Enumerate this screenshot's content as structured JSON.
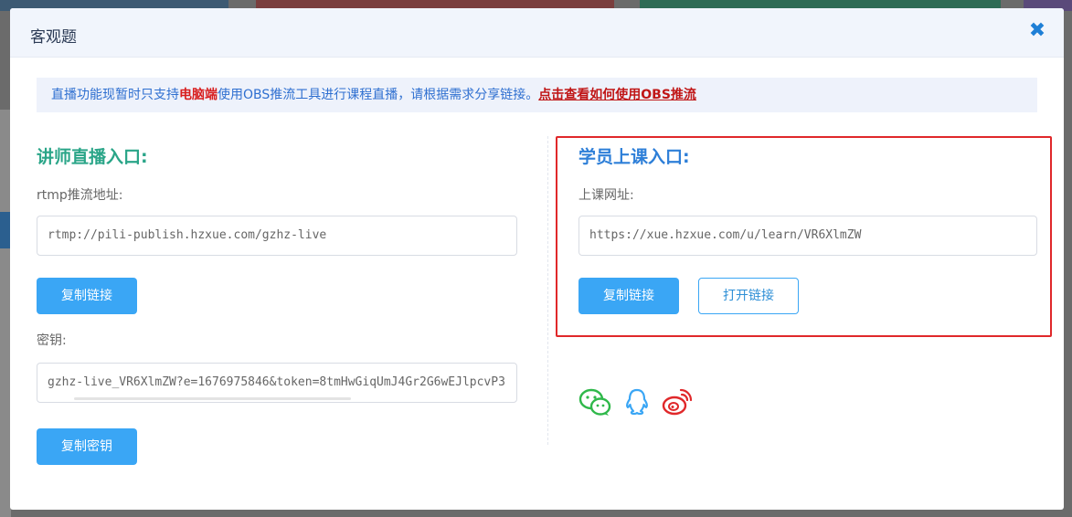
{
  "modal": {
    "title": "客观题",
    "close_symbol": "✖"
  },
  "notice": {
    "text_part1": "直播功能现暂时只支持",
    "text_highlight": "电脑端",
    "text_part2": "使用OBS推流工具进行课程直播，请根据需求分享链接。",
    "link_text": "点击查看如何使用OBS推流"
  },
  "teacher": {
    "title": "讲师直播入口:",
    "rtmp_label": "rtmp推流地址:",
    "rtmp_value": "rtmp://pili-publish.hzxue.com/gzhz-live",
    "copy_link_label": "复制链接",
    "key_label": "密钥:",
    "key_value": "gzhz-live_VR6XlmZW?e=1676975846&token=8tmHwGiqUmJ4Gr2G6wEJlpcvP3",
    "copy_key_label": "复制密钥"
  },
  "student": {
    "title": "学员上课入口:",
    "url_label": "上课网址:",
    "url_value": "https://xue.hzxue.com/u/learn/VR6XlmZW",
    "copy_link_label": "复制链接",
    "open_link_label": "打开链接"
  },
  "share": {
    "icons": [
      "wechat-icon",
      "qq-icon",
      "weibo-icon"
    ]
  },
  "colors": {
    "teacher_title": "#2aa588",
    "student_title": "#2e7fd8",
    "primary_button": "#3aa6f5",
    "highlight_border": "#e0282a"
  }
}
